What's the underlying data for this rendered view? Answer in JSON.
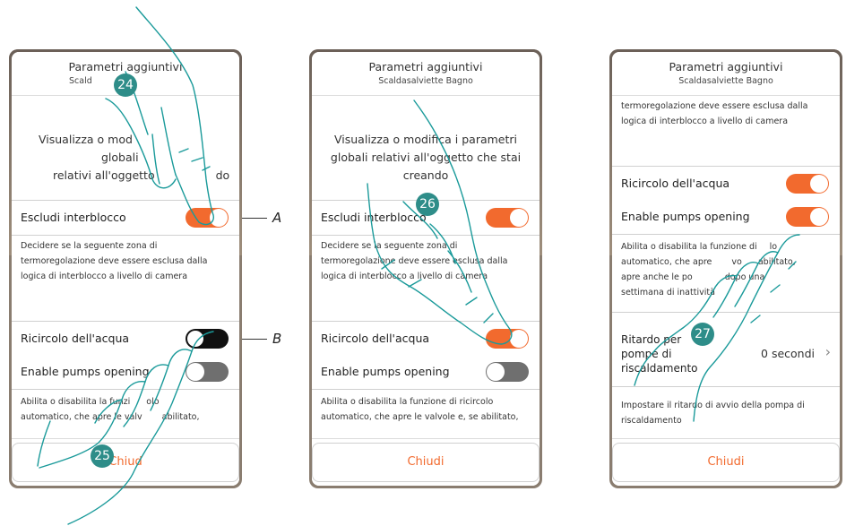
{
  "header": {
    "title": "Parametri aggiuntivi",
    "subtitle": "Scaldasalviette Bagno",
    "subtitle_obscured": "Scald"
  },
  "intro": "Visualizza o modifica i parametri globali relativi all'oggetto che stai creando",
  "intro_obscured": {
    "line1a": "Visualizza o mod",
    "line1b": "globali",
    "line2a": "relativi all'oggetto",
    "line2b": "do"
  },
  "settings": {
    "escludi_label": "Escludi interblocco",
    "escludi_desc": "Decidere se la seguente zona di termoregolazione deve essere esclusa dalla logica di interblocco a livello di camera",
    "ricircolo_label": "Ricircolo dell'acqua",
    "pumps_label": "Enable pumps opening",
    "pumps_desc": "Abilita o disabilita la funzione di ricircolo automatico, che apre le valvole e, se abilitato,",
    "pumps_desc_full": "Abilita o disabilita la funzione di ricircolo automatico, che apre le valvole e, se abilitato, apre anche le pompe dopo una settimana di inattività",
    "ritardo_label": "Ritardo per pompe di riscaldamento",
    "ritardo_value": "0 secondi",
    "ritardo_desc": "Impostare il ritardo di avvio della pompa di riscaldamento"
  },
  "panel3_fragments": {
    "pumps_desc": [
      "Abilita o disabilita la funzione di",
      "lo",
      "automatico, che apre",
      "vo",
      "abilitato,",
      "apre anche le po",
      "dopo una",
      "settimana di inattività"
    ],
    "ritardo_label": [
      "Ritardo per",
      "pompe di",
      "riscaldamento"
    ]
  },
  "panel1_fragments": {
    "pumps_label": "Enable pumps opening",
    "pumps_desc": [
      "Abilita o disabilita la funzi",
      "olo",
      "automatico, che apre le valv",
      "abilitato,"
    ]
  },
  "states": {
    "panel1": {
      "escludi": "on",
      "ricircolo": "off-black",
      "pumps": "off"
    },
    "panel2": {
      "escludi": "on",
      "ricircolo": "on",
      "pumps": "off"
    },
    "panel3": {
      "ricircolo": "on",
      "pumps": "on"
    }
  },
  "footer": {
    "close_label": "Chiudi",
    "close_obscured": "Chiud"
  },
  "steps": [
    "24",
    "25",
    "26",
    "27"
  ],
  "callouts": {
    "a": "A",
    "b": "B"
  },
  "colors": {
    "accent": "#f26a2e",
    "step": "#2e8d89",
    "hand_line": "#1a9a9a"
  },
  "icons": {
    "chevron": "chevron-right-icon",
    "hand": "pointing-hand-icon"
  }
}
